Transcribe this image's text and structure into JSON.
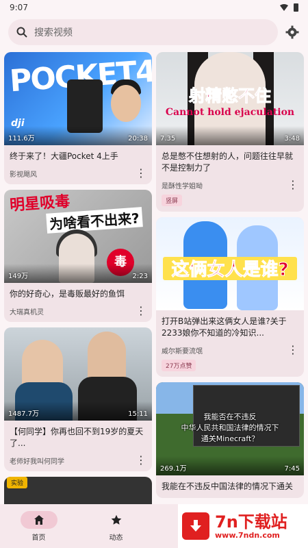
{
  "status": {
    "time": "9:07"
  },
  "search": {
    "placeholder": "搜索视频"
  },
  "colors": {
    "accent": "#f1c9d4",
    "card": "#f1e3e7",
    "background": "#fbf4f6",
    "watermark_red": "#e02020"
  },
  "feed": {
    "left": [
      {
        "views": "111.6万",
        "duration": "20:38",
        "title": "终于来了！大疆Pocket 4上手",
        "author": "影视飓风",
        "thumb_text": {
          "big": "POCKET4",
          "logo": "dji"
        }
      },
      {
        "views": "149万",
        "duration": "2:23",
        "title": "你的好奇心，是毒贩最好的鱼饵",
        "author": "大瑞真机灵",
        "thumb_text": {
          "line1": "明星吸毒",
          "line2": "为啥看不出来?",
          "sign": "毒"
        }
      },
      {
        "views": "1487.7万",
        "duration": "15:11",
        "title": "【何同学】你再也回不到19岁的夏天了...",
        "author": "老师好我叫何同学"
      }
    ],
    "right": [
      {
        "views": "7.35",
        "duration": "3:48",
        "title": "总是憋不住想射的人，问题往往早就不是控制力了",
        "author": "是酥性学姐呦",
        "badge": "竖屏",
        "thumb_text": {
          "line1": "射精憋不住",
          "line2": "Cannot hold ejaculation"
        }
      },
      {
        "title": "打开B站弹出来这俩女人是谁?关于2233娘你不知道的冷知识...",
        "author": "威尔斯要流氓",
        "badge": "27万点赞",
        "thumb_text": {
          "caption": "这俩女人是谁?"
        }
      },
      {
        "views": "269.1万",
        "duration": "7:45",
        "title": "我能在不违反中国法律的情况下通关",
        "author": "",
        "thumb_text": {
          "sub1": "我能否在不违反",
          "sub2": "中华人民共和国法律的情况下",
          "sub3": "通关Minecraft？"
        }
      }
    ]
  },
  "partial_badge": "实验",
  "nav": {
    "items": [
      {
        "label": "首页",
        "icon": "home-icon"
      },
      {
        "label": "动态",
        "icon": "star-icon"
      }
    ]
  },
  "watermark": {
    "title": "7n下载站",
    "url": "www.7ndn.com"
  }
}
